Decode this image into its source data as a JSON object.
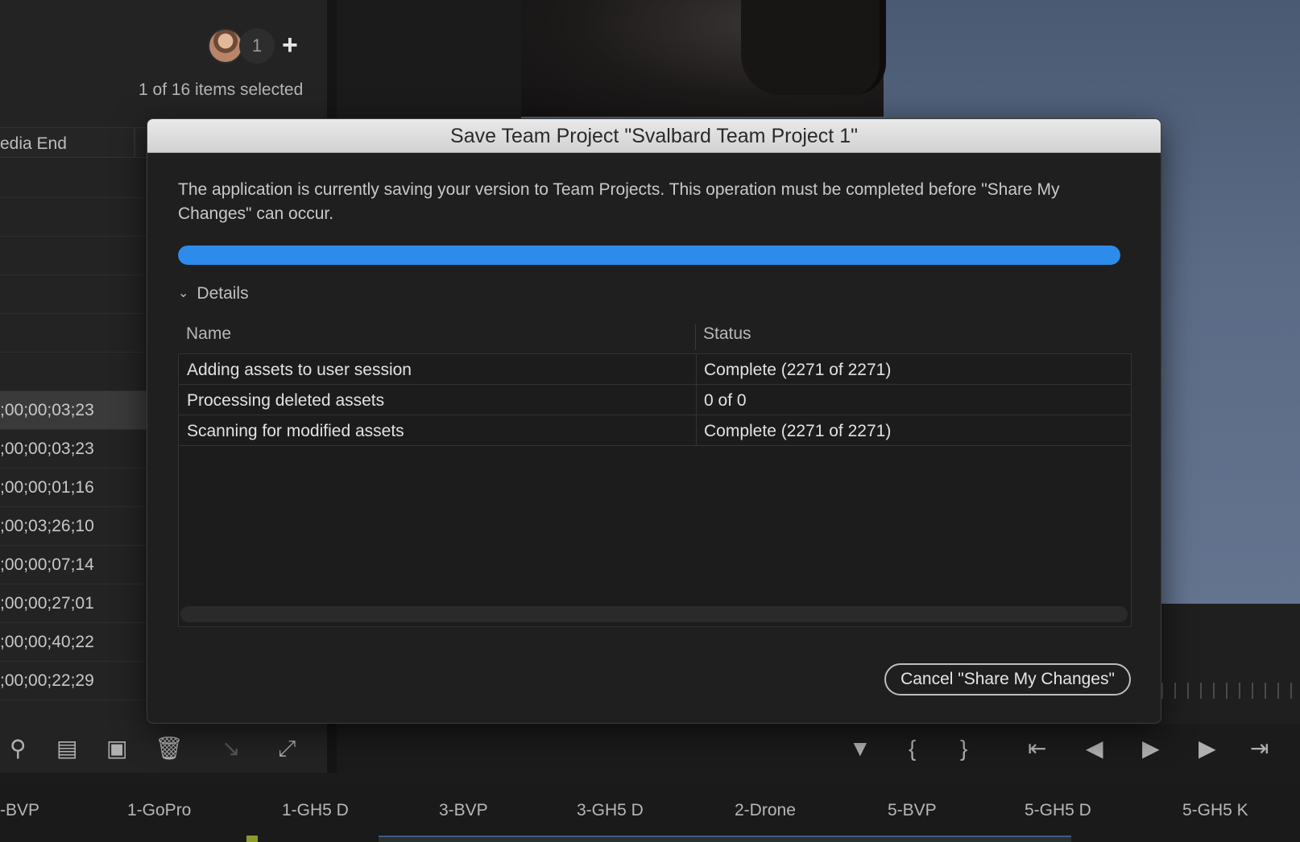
{
  "project_panel": {
    "collaborator_count": "1",
    "add_icon": "plus-icon",
    "selected_text": "1 of 16 items selected",
    "column_header": "edia End",
    "timecodes": [
      ";00;00;03;23",
      ";00;00;03;23",
      ";00;00;01;16",
      ";00;03;26;10",
      ";00;00;07;14",
      ";00;00;27;01",
      ";00;00;40;22",
      ";00;00;22;29"
    ],
    "toolbar_icons": [
      "search-icon",
      "new-bin-icon",
      "new-item-icon",
      "trash-icon",
      "automate-to-sequence-icon",
      "resize-icon"
    ]
  },
  "monitor_toolbar": {
    "icons": [
      "marker-icon",
      "mark-in-icon",
      "mark-out-icon",
      "go-to-in-icon",
      "step-back-icon",
      "play-icon",
      "step-forward-icon",
      "go-to-out-icon"
    ]
  },
  "tracks": [
    "-BVP",
    "1-GoPro",
    "1-GH5 D",
    "3-BVP",
    "3-GH5 D",
    "2-Drone",
    "5-BVP",
    "5-GH5 D",
    "5-GH5 K"
  ],
  "dialog": {
    "title": "Save Team Project \"Svalbard Team Project 1\"",
    "message": "The application is currently saving your version to Team Projects. This operation must be completed before \"Share My Changes\" can occur.",
    "progress_percent": 100,
    "progress_color": "#2d8ceb",
    "details_label": "Details",
    "columns": {
      "name": "Name",
      "status": "Status"
    },
    "rows": [
      {
        "name": "Adding assets to user session",
        "status": "Complete (2271 of 2271)"
      },
      {
        "name": "Processing deleted assets",
        "status": "0 of 0"
      },
      {
        "name": "Scanning for modified assets",
        "status": "Complete (2271 of 2271)"
      }
    ],
    "cancel_label": "Cancel \"Share My Changes\""
  }
}
